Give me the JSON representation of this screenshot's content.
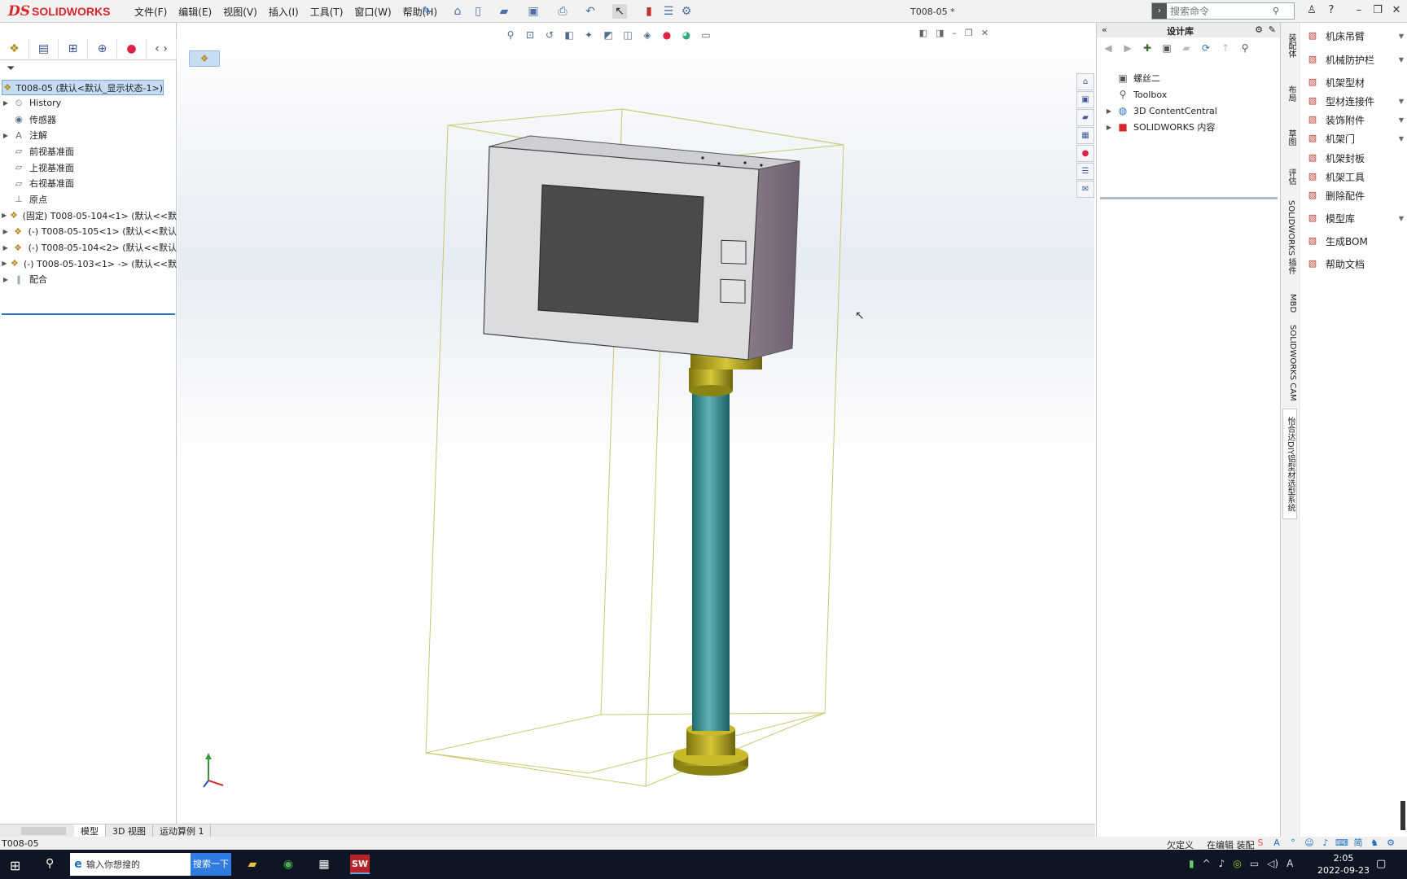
{
  "app": {
    "brand_mark": "DS",
    "brand_name": "SOLIDWORKS",
    "document_title": "T008-05 *",
    "command_search_placeholder": "搜索命令"
  },
  "menus": [
    "文件(F)",
    "编辑(E)",
    "视图(V)",
    "插入(I)",
    "工具(T)",
    "窗口(W)",
    "帮助(H)"
  ],
  "feature_tree": {
    "root": "T008-05  (默认<默认_显示状态-1>)",
    "items": [
      {
        "label": "History",
        "icon": "history-icon",
        "expandable": true
      },
      {
        "label": "传感器",
        "icon": "sensor-icon",
        "expandable": false
      },
      {
        "label": "注解",
        "icon": "annotation-icon",
        "expandable": true
      },
      {
        "label": "前视基准面",
        "icon": "plane-icon",
        "expandable": false
      },
      {
        "label": "上视基准面",
        "icon": "plane-icon",
        "expandable": false
      },
      {
        "label": "右视基准面",
        "icon": "plane-icon",
        "expandable": false
      },
      {
        "label": "原点",
        "icon": "origin-icon",
        "expandable": false
      },
      {
        "label": "(固定) T008-05-104<1> (默认<<默",
        "icon": "part-icon",
        "expandable": true
      },
      {
        "label": "(-) T008-05-105<1> (默认<<默认",
        "icon": "part-icon",
        "expandable": true
      },
      {
        "label": "(-) T008-05-104<2> (默认<<默认",
        "icon": "part-icon",
        "expandable": true
      },
      {
        "label": "(-) T008-05-103<1> -> (默认<<默",
        "icon": "part-icon",
        "expandable": true
      },
      {
        "label": "配合",
        "icon": "mates-icon",
        "expandable": true
      }
    ]
  },
  "bottom_tabs": [
    "模型",
    "3D 视图",
    "运动算例 1"
  ],
  "status": {
    "left": "T008-05",
    "right": [
      "欠定义",
      "在编辑 装配"
    ]
  },
  "design_library": {
    "title": "设计库",
    "items": [
      {
        "label": "螺丝二",
        "icon": "folder-icon",
        "expandable": false
      },
      {
        "label": "Toolbox",
        "icon": "toolbox-icon",
        "expandable": false
      },
      {
        "label": "3D ContentCentral",
        "icon": "globe-icon",
        "expandable": true
      },
      {
        "label": "SOLIDWORKS 内容",
        "icon": "sw-content-icon",
        "expandable": true
      }
    ]
  },
  "vertical_tabs": [
    "装配体",
    "布局",
    "草图",
    "评估",
    "SOLIDWORKS 插件",
    "MBD",
    "SOLIDWORKS CAM",
    "怡合达DIY铝型材选型系统"
  ],
  "side_panel": [
    {
      "label": "机床吊臂",
      "dropdown": true
    },
    {
      "label": "机械防护栏",
      "dropdown": true
    },
    {
      "label": "机架型材",
      "dropdown": false
    },
    {
      "label": "型材连接件",
      "dropdown": true
    },
    {
      "label": "装饰附件",
      "dropdown": true
    },
    {
      "label": "机架门",
      "dropdown": true
    },
    {
      "label": "机架封板",
      "dropdown": false
    },
    {
      "label": "机架工具",
      "dropdown": false
    },
    {
      "label": "删除配件",
      "dropdown": false
    },
    {
      "label": "模型库",
      "dropdown": true
    },
    {
      "label": "生成BOM",
      "dropdown": false
    },
    {
      "label": "帮助文档",
      "dropdown": false
    }
  ],
  "taskbar": {
    "search_placeholder": "输入你想搜的",
    "search_button": "搜索一下",
    "time": "2:05",
    "date": "2022-09-23",
    "ime": "A"
  },
  "colors": {
    "brand_red": "#d8262b",
    "selection_blue": "#c6dcf3",
    "model_housing": "#d8d8da",
    "model_screen": "#4a4a4a",
    "model_pole": "#2e8b8b",
    "model_brass": "#b5a31a",
    "bounding_box": "#c8c870"
  }
}
